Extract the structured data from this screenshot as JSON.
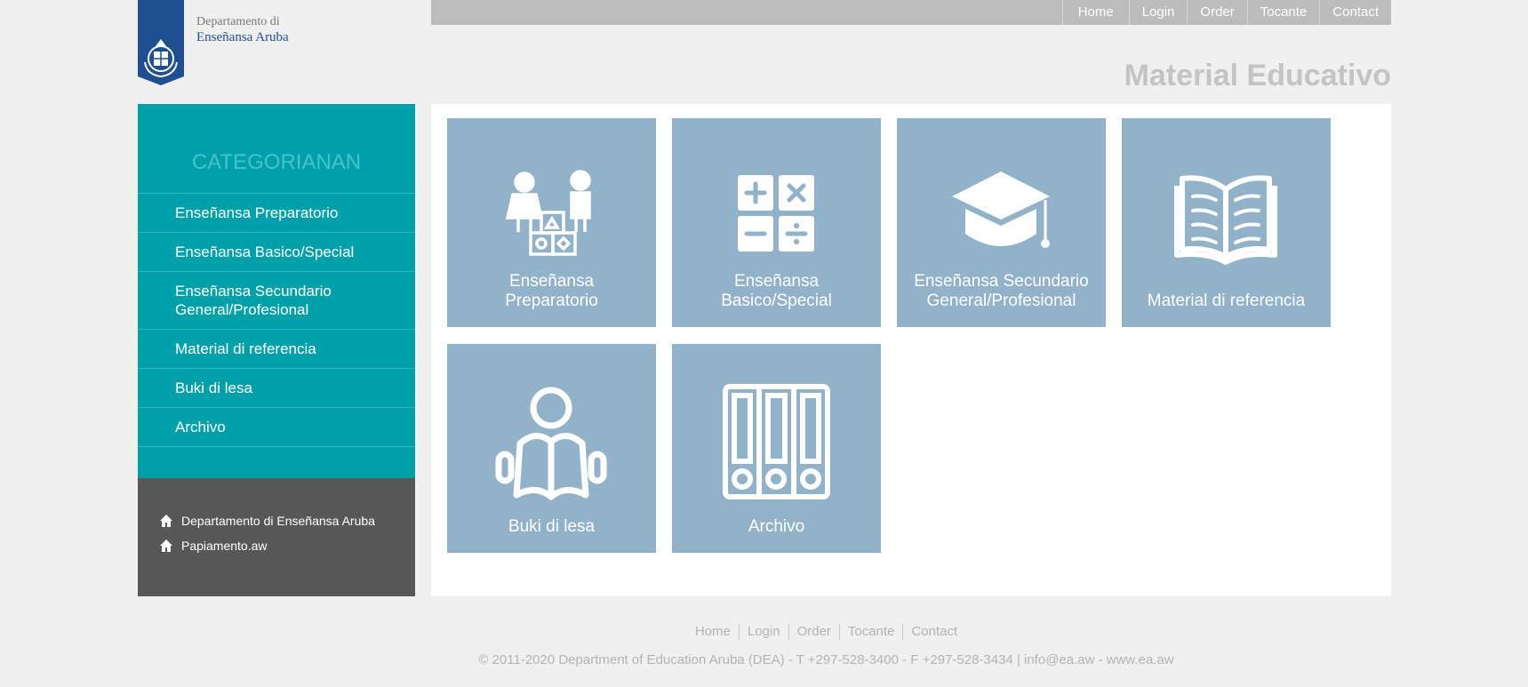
{
  "logo": {
    "line1": "Departamento di",
    "line2": "Enseñansa Aruba",
    "shield_color": "#1d4f91"
  },
  "topnav": [
    "Home",
    "Login",
    "Order",
    "Tocante",
    "Contact"
  ],
  "page_title": "Material Educativo",
  "sidebar": {
    "heading": "CATEGORIANAN",
    "items": [
      {
        "label": "Enseñansa Preparatorio"
      },
      {
        "label": "Enseñansa Basico/Special"
      },
      {
        "label": "Enseñansa Secundario General/Profesional"
      },
      {
        "label": "Material di referencia"
      },
      {
        "label": "Buki di lesa"
      },
      {
        "label": "Archivo"
      }
    ]
  },
  "links": [
    {
      "label": "Departamento di Enseñansa Aruba",
      "icon": "home-icon"
    },
    {
      "label": "Papiamento.aw",
      "icon": "home-icon"
    }
  ],
  "tiles": [
    {
      "line1": "Enseñansa",
      "line2": "Preparatorio",
      "icon": "children-blocks-icon"
    },
    {
      "line1": "Enseñansa",
      "line2": "Basico/Special",
      "icon": "calculator-icon"
    },
    {
      "line1": "Enseñansa Secundario",
      "line2": "General/Profesional",
      "icon": "graduation-cap-icon"
    },
    {
      "line1": "",
      "line2": "Material di referencia",
      "icon": "open-book-icon"
    },
    {
      "line1": "",
      "line2": "Buki di lesa",
      "icon": "reader-icon"
    },
    {
      "line1": "",
      "line2": "Archivo",
      "icon": "binders-icon"
    }
  ],
  "footer": {
    "nav": [
      "Home",
      "Login",
      "Order",
      "Tocante",
      "Contact"
    ],
    "copyright": "© 2011-2020 Department of Education Aruba (DEA) - T +297-528-3400 - F +297-528-3434 | info@ea.aw - www.ea.aw"
  },
  "colors": {
    "teal": "#00a0ab",
    "tile": "#91b2c9",
    "dark": "#575757",
    "topbar": "#bcbcbc"
  }
}
